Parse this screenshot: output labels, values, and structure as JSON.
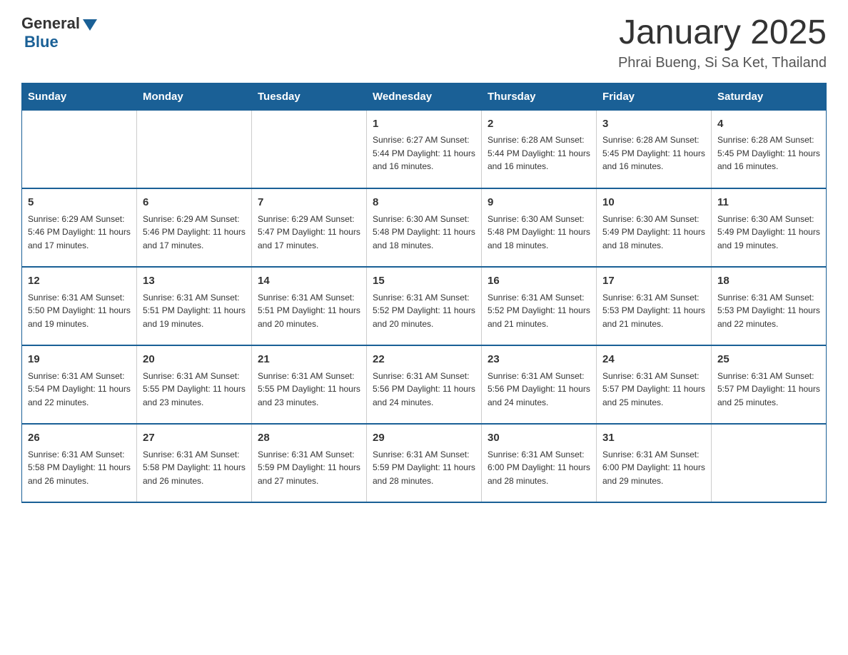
{
  "header": {
    "logo_general": "General",
    "logo_blue": "Blue",
    "main_title": "January 2025",
    "subtitle": "Phrai Bueng, Si Sa Ket, Thailand"
  },
  "days_of_week": [
    "Sunday",
    "Monday",
    "Tuesday",
    "Wednesday",
    "Thursday",
    "Friday",
    "Saturday"
  ],
  "weeks": [
    [
      {
        "day": "",
        "info": ""
      },
      {
        "day": "",
        "info": ""
      },
      {
        "day": "",
        "info": ""
      },
      {
        "day": "1",
        "info": "Sunrise: 6:27 AM\nSunset: 5:44 PM\nDaylight: 11 hours and 16 minutes."
      },
      {
        "day": "2",
        "info": "Sunrise: 6:28 AM\nSunset: 5:44 PM\nDaylight: 11 hours and 16 minutes."
      },
      {
        "day": "3",
        "info": "Sunrise: 6:28 AM\nSunset: 5:45 PM\nDaylight: 11 hours and 16 minutes."
      },
      {
        "day": "4",
        "info": "Sunrise: 6:28 AM\nSunset: 5:45 PM\nDaylight: 11 hours and 16 minutes."
      }
    ],
    [
      {
        "day": "5",
        "info": "Sunrise: 6:29 AM\nSunset: 5:46 PM\nDaylight: 11 hours and 17 minutes."
      },
      {
        "day": "6",
        "info": "Sunrise: 6:29 AM\nSunset: 5:46 PM\nDaylight: 11 hours and 17 minutes."
      },
      {
        "day": "7",
        "info": "Sunrise: 6:29 AM\nSunset: 5:47 PM\nDaylight: 11 hours and 17 minutes."
      },
      {
        "day": "8",
        "info": "Sunrise: 6:30 AM\nSunset: 5:48 PM\nDaylight: 11 hours and 18 minutes."
      },
      {
        "day": "9",
        "info": "Sunrise: 6:30 AM\nSunset: 5:48 PM\nDaylight: 11 hours and 18 minutes."
      },
      {
        "day": "10",
        "info": "Sunrise: 6:30 AM\nSunset: 5:49 PM\nDaylight: 11 hours and 18 minutes."
      },
      {
        "day": "11",
        "info": "Sunrise: 6:30 AM\nSunset: 5:49 PM\nDaylight: 11 hours and 19 minutes."
      }
    ],
    [
      {
        "day": "12",
        "info": "Sunrise: 6:31 AM\nSunset: 5:50 PM\nDaylight: 11 hours and 19 minutes."
      },
      {
        "day": "13",
        "info": "Sunrise: 6:31 AM\nSunset: 5:51 PM\nDaylight: 11 hours and 19 minutes."
      },
      {
        "day": "14",
        "info": "Sunrise: 6:31 AM\nSunset: 5:51 PM\nDaylight: 11 hours and 20 minutes."
      },
      {
        "day": "15",
        "info": "Sunrise: 6:31 AM\nSunset: 5:52 PM\nDaylight: 11 hours and 20 minutes."
      },
      {
        "day": "16",
        "info": "Sunrise: 6:31 AM\nSunset: 5:52 PM\nDaylight: 11 hours and 21 minutes."
      },
      {
        "day": "17",
        "info": "Sunrise: 6:31 AM\nSunset: 5:53 PM\nDaylight: 11 hours and 21 minutes."
      },
      {
        "day": "18",
        "info": "Sunrise: 6:31 AM\nSunset: 5:53 PM\nDaylight: 11 hours and 22 minutes."
      }
    ],
    [
      {
        "day": "19",
        "info": "Sunrise: 6:31 AM\nSunset: 5:54 PM\nDaylight: 11 hours and 22 minutes."
      },
      {
        "day": "20",
        "info": "Sunrise: 6:31 AM\nSunset: 5:55 PM\nDaylight: 11 hours and 23 minutes."
      },
      {
        "day": "21",
        "info": "Sunrise: 6:31 AM\nSunset: 5:55 PM\nDaylight: 11 hours and 23 minutes."
      },
      {
        "day": "22",
        "info": "Sunrise: 6:31 AM\nSunset: 5:56 PM\nDaylight: 11 hours and 24 minutes."
      },
      {
        "day": "23",
        "info": "Sunrise: 6:31 AM\nSunset: 5:56 PM\nDaylight: 11 hours and 24 minutes."
      },
      {
        "day": "24",
        "info": "Sunrise: 6:31 AM\nSunset: 5:57 PM\nDaylight: 11 hours and 25 minutes."
      },
      {
        "day": "25",
        "info": "Sunrise: 6:31 AM\nSunset: 5:57 PM\nDaylight: 11 hours and 25 minutes."
      }
    ],
    [
      {
        "day": "26",
        "info": "Sunrise: 6:31 AM\nSunset: 5:58 PM\nDaylight: 11 hours and 26 minutes."
      },
      {
        "day": "27",
        "info": "Sunrise: 6:31 AM\nSunset: 5:58 PM\nDaylight: 11 hours and 26 minutes."
      },
      {
        "day": "28",
        "info": "Sunrise: 6:31 AM\nSunset: 5:59 PM\nDaylight: 11 hours and 27 minutes."
      },
      {
        "day": "29",
        "info": "Sunrise: 6:31 AM\nSunset: 5:59 PM\nDaylight: 11 hours and 28 minutes."
      },
      {
        "day": "30",
        "info": "Sunrise: 6:31 AM\nSunset: 6:00 PM\nDaylight: 11 hours and 28 minutes."
      },
      {
        "day": "31",
        "info": "Sunrise: 6:31 AM\nSunset: 6:00 PM\nDaylight: 11 hours and 29 minutes."
      },
      {
        "day": "",
        "info": ""
      }
    ]
  ]
}
